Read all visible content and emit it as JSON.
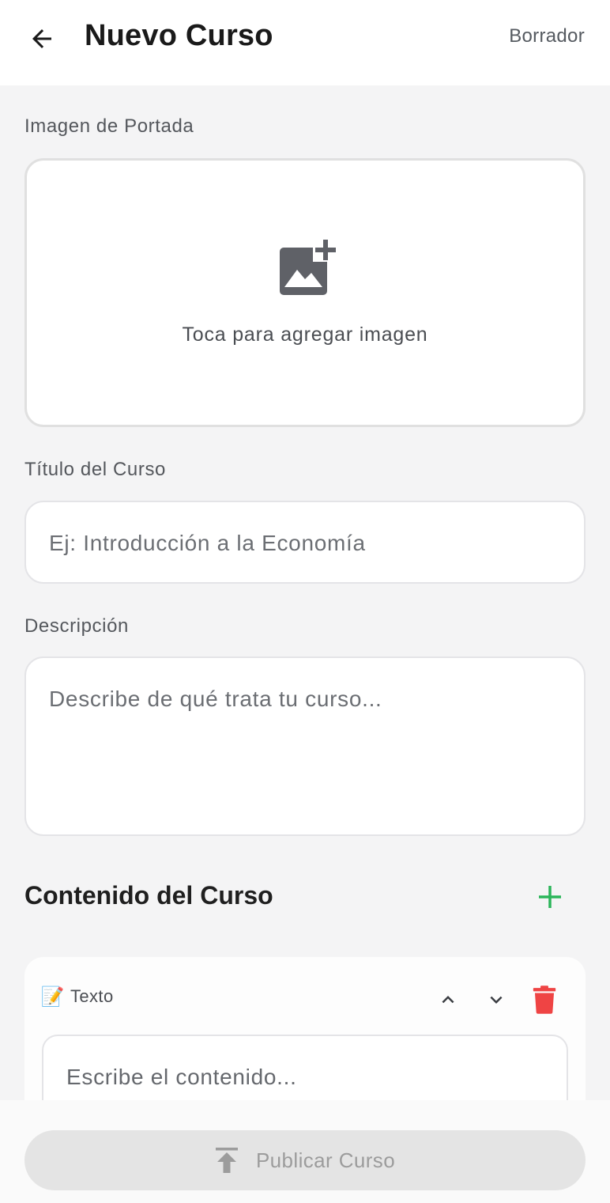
{
  "header": {
    "back_icon": "arrow-left-icon",
    "title": "Nuevo Curso",
    "draft_label": "Borrador"
  },
  "cover": {
    "label": "Imagen de Portada",
    "icon": "add-photo-icon",
    "hint": "Toca para agregar imagen"
  },
  "title_field": {
    "label": "Título del Curso",
    "placeholder": "Ej: Introducción a la Economía"
  },
  "description_field": {
    "label": "Descripción",
    "placeholder": "Describe de qué trata tu curso..."
  },
  "content": {
    "title": "Contenido del Curso",
    "add_icon": "plus-icon",
    "blocks": [
      {
        "emoji": "📝",
        "type_label": "Texto",
        "placeholder": "Escribe el contenido...",
        "move_up_icon": "chevron-up-icon",
        "move_down_icon": "chevron-down-icon",
        "delete_icon": "trash-icon"
      }
    ]
  },
  "footer": {
    "publish_icon": "publish-upload-icon",
    "publish_label": "Publicar Curso"
  },
  "colors": {
    "accent_green": "#2bb55a",
    "delete_red": "#ef4444",
    "disabled_text": "#9c9c9c"
  }
}
